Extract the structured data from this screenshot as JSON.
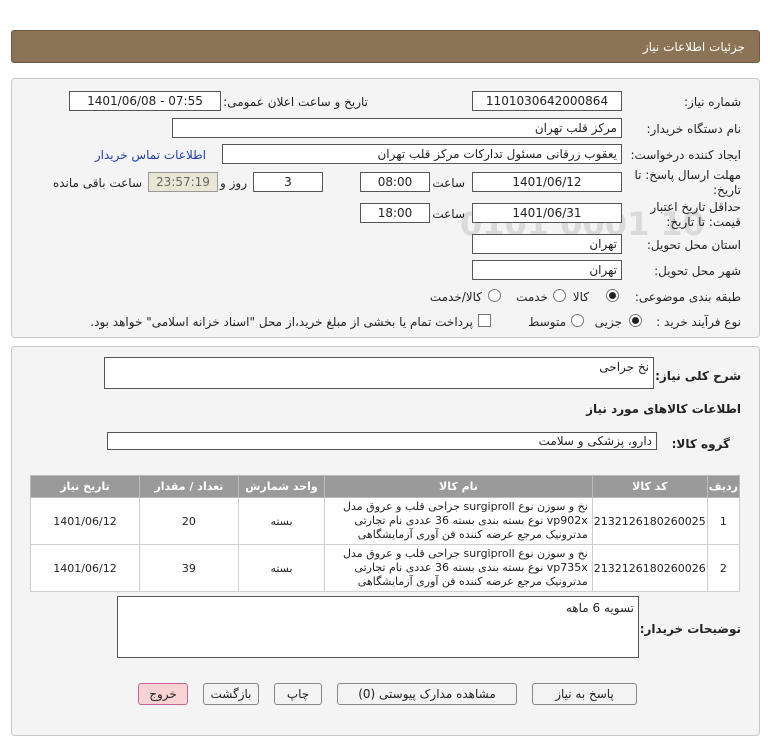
{
  "header": {
    "title": "جزئیات اطلاعات نیاز"
  },
  "form": {
    "need_number_label": "شماره نیاز:",
    "need_number": "1101030642000864",
    "announce_label": "تاریخ و ساعت اعلان عمومی:",
    "announce_value": "1401/06/08 - 07:55",
    "buyer_label": "نام دستگاه خریدار:",
    "buyer_value": "مرکز قلب تهران",
    "creator_label": "ایجاد کننده درخواست:",
    "creator_value": "یعقوب زرقانی مسئول تدارکات مرکز قلب تهران",
    "contact_link": "اطلاعات تماس خریدار",
    "deadline_label_1": "مهلت ارسال پاسخ: تا",
    "deadline_label_2": "تاریخ:",
    "deadline_date": "1401/06/12",
    "time_label": "ساعت",
    "deadline_time": "08:00",
    "days_value": "3",
    "days_label": "روز و",
    "remaining_time": "23:57:19",
    "remaining_label": "ساعت باقی مانده",
    "validity_label_1": "حداقل تاریخ اعتبار",
    "validity_label_2": "قیمت: تا تاریخ:",
    "validity_date": "1401/06/31",
    "validity_time_label": "ساعت",
    "validity_time": "18:00",
    "province_label": "استان محل تحویل:",
    "province_value": "تهران",
    "city_label": "شهر محل تحویل:",
    "city_value": "تهران",
    "category_label": "طبقه بندی موضوعی:",
    "category_options": [
      "کالا",
      "خدمت",
      "کالا/خدمت"
    ],
    "process_label": "نوع فرآیند خرید :",
    "process_options": [
      "جزیی",
      "متوسط"
    ],
    "payment_note": "پرداخت تمام یا بخشی از مبلغ خرید،از محل \"اسناد خزانه اسلامی\" خواهد بود."
  },
  "summary": {
    "description_label": "شرح کلی نیاز:",
    "description_value": "نخ جراحی",
    "items_info_title": "اطلاعات کالاهای مورد نیاز",
    "group_label": "گروه کالا:",
    "group_value": "دارو، پزشکی و سلامت"
  },
  "table": {
    "headers": [
      "ردیف",
      "کد کالا",
      "نام کالا",
      "واحد شمارش",
      "تعداد / مقدار",
      "تاریخ نیاز"
    ],
    "rows": [
      {
        "row": "1",
        "code": "2132126180260025",
        "name": "نخ و سوزن نوع surgiproll جراحی قلب و عروق مدل vp902x نوع بسته بندی بسته 36 عددی نام تجارتی مدترونیک مرجع عرضه کننده فن آوری آزمایشگاهی",
        "unit": "بسته",
        "qty": "20",
        "date": "1401/06/12"
      },
      {
        "row": "2",
        "code": "2132126180260026",
        "name": "نخ و سوزن نوع surgiproll جراحی قلب و عروق مدل vp735x نوع بسته بندی بسته 36 عددی نام تجارتی مدترونیک مرجع عرضه کننده فن آوری آزمایشگاهی",
        "unit": "بسته",
        "qty": "39",
        "date": "1401/06/12"
      }
    ]
  },
  "notes": {
    "label": "توضیحات خریدار:",
    "value": "تسویه 6 ماهه"
  },
  "buttons": {
    "reply": "پاسخ به نیاز",
    "attachments": "مشاهده مدارک پیوستی (0)",
    "print": "چاپ",
    "back": "بازگشت",
    "exit": "خروج"
  },
  "watermark": {
    "brand": "ParsNamadData",
    "line1": "پایگاه اطلاع رسانی مناقصات و مزایده",
    "line2": "فن آوری اطلاعات پارس نماد داده",
    "phone": "۰۲۱-۸۸۳۴۹۶۷۰",
    "code": "0101 0001 10"
  },
  "colors": {
    "header_bg": "#8b7355",
    "table_header_bg": "#9a9a9a",
    "exit_bg": "#f8d3d3",
    "link": "#1f3fb0"
  }
}
